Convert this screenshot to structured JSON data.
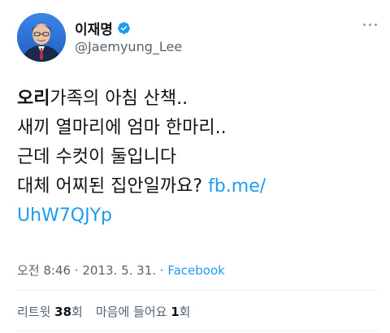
{
  "user": {
    "name": "이재명",
    "handle": "@Jaemyung_Lee",
    "verified": true
  },
  "tweet": {
    "line1_bold": "오리",
    "line1_rest": "가족의 아침 산책..",
    "line2": "새끼 열마리에 엄마 한마리..",
    "line3": "근데 수컷이 둘입니다",
    "line4_text": "대체 어찌된 집안일까요? ",
    "link_part1": "fb.me/",
    "link_part2": "UhW7QJYp"
  },
  "meta": {
    "time": "오전 8:46",
    "sep1": " · ",
    "date": "2013. 5. 31.",
    "sep2": " · ",
    "source": "Facebook"
  },
  "stats": {
    "retweets_label": "리트윗 ",
    "retweets_count": "38",
    "retweets_unit": "회",
    "likes_label": "마음에 들어요 ",
    "likes_count": "1",
    "likes_unit": "회"
  },
  "colors": {
    "link": "#1d9bf0",
    "secondary_text": "#536471",
    "primary_text": "#0f1419",
    "verified_badge": "#1d9bf0"
  },
  "icons": {
    "verified": "verified-badge-icon",
    "more": "more-options-icon"
  }
}
